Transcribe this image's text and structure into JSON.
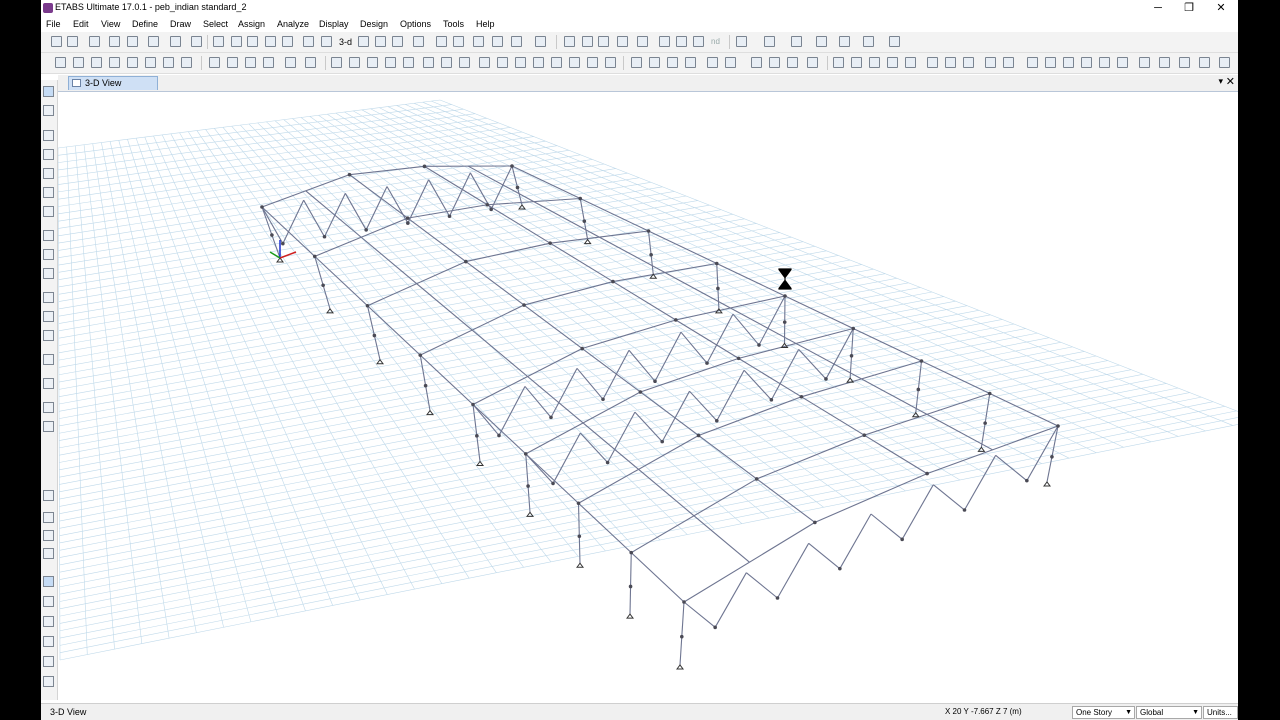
{
  "window": {
    "title": "ETABS Ultimate 17.0.1 - peb_indian standard_2",
    "minimize_glyph": "─",
    "maximize_glyph": "❐",
    "close_glyph": "✕"
  },
  "menu": [
    "File",
    "Edit",
    "View",
    "Define",
    "Draw",
    "Select",
    "Assign",
    "Analyze",
    "Display",
    "Design",
    "Options",
    "Tools",
    "Help"
  ],
  "toolbar": {
    "view_3d_label": "3-d",
    "nd_label": "nd"
  },
  "tab": {
    "label": "3-D View",
    "dropdown_glyph": "▾",
    "close_glyph": "✕"
  },
  "statusbar": {
    "view_label": "3-D View",
    "coordinates": "X 20  Y -7.667  Z 7 (m)",
    "story_option": "One Story",
    "coord_system": "Global",
    "units_label": "Units..."
  },
  "icons": [
    "pointer-icon",
    "reshape-icon",
    "draw-line-icon",
    "draw-area-icon",
    "section-cut-icon",
    "zoom-in-icon",
    "zoom-out-icon",
    "pan-icon",
    "hourglass-cursor-icon"
  ]
}
